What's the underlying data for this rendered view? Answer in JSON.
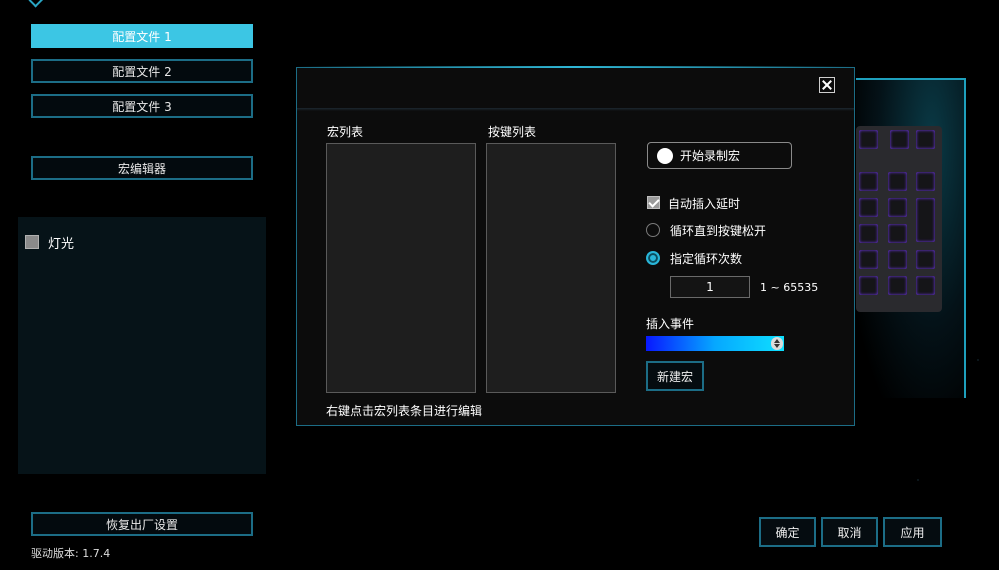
{
  "sidebar": {
    "profiles": [
      "配置文件 1",
      "配置文件 2",
      "配置文件 3"
    ],
    "macro_editor": "宏编辑器",
    "light_label": "灯光",
    "factory_reset": "恢复出厂设置",
    "driver_version": "驱动版本: 1.7.4"
  },
  "dialog": {
    "macro_list_label": "宏列表",
    "key_list_label": "按键列表",
    "record_button": "开始录制宏",
    "auto_insert_delay": "自动插入延时",
    "loop_until_release": "循环直到按键松开",
    "specified_loop_count": "指定循环次数",
    "loop_count_value": "1",
    "loop_range": "1 ~ 65535",
    "insert_event_label": "插入事件",
    "new_macro_button": "新建宏",
    "hint": "右键点击宏列表条目进行编辑"
  },
  "footer": {
    "ok": "确定",
    "cancel": "取消",
    "apply": "应用"
  },
  "colors": {
    "accent": "#3cc6e4",
    "border": "#1c6d86",
    "insert_event_gradient_start": "#0818ff",
    "insert_event_gradient_end": "#0ee0ff"
  }
}
